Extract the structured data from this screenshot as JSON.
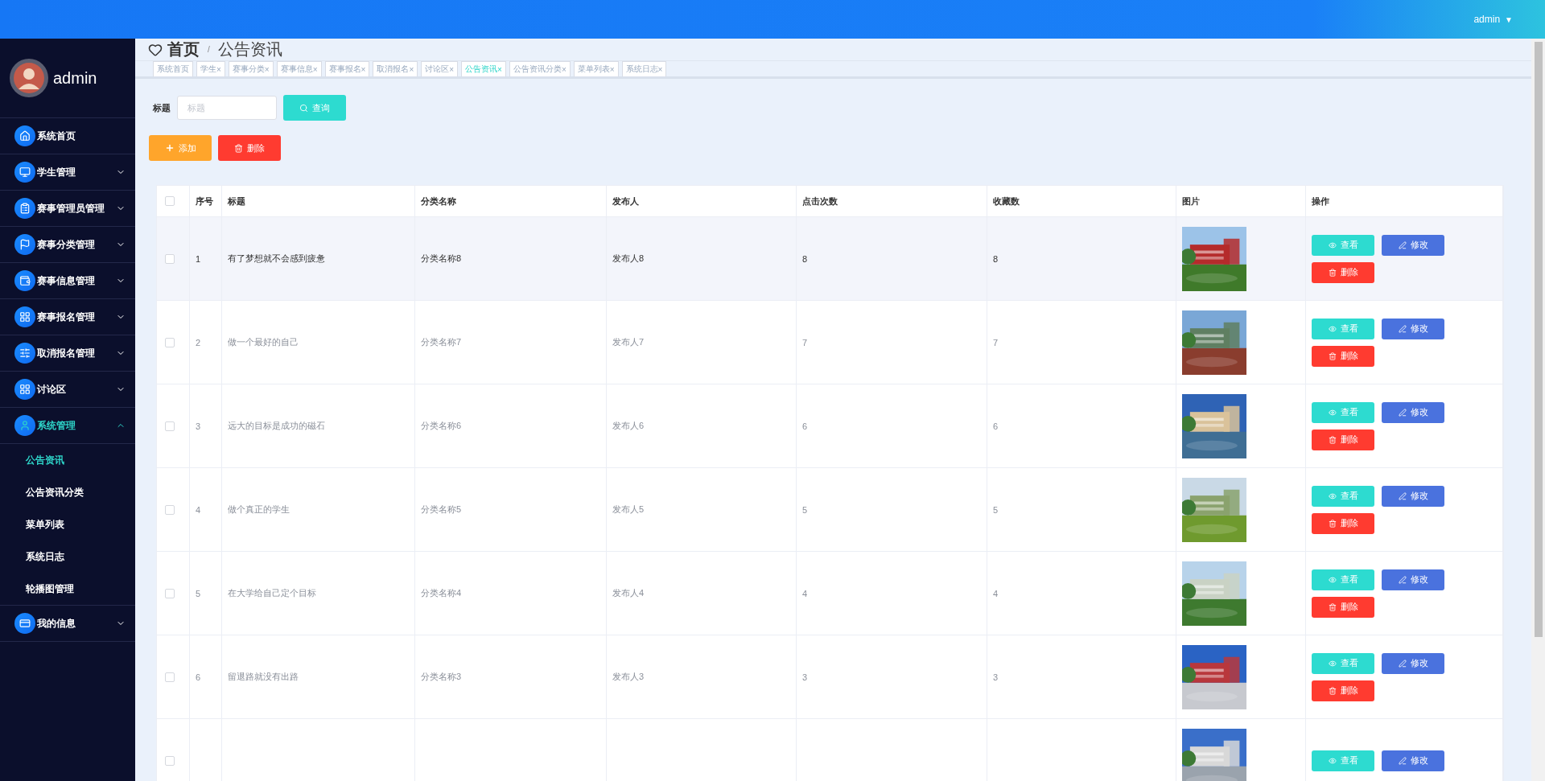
{
  "topbar": {
    "user": "admin",
    "caret": "▼"
  },
  "sidebar": {
    "username": "admin",
    "items": [
      {
        "label": "系统首页",
        "selected": false
      },
      {
        "label": "学生管理",
        "expanded": false,
        "selected": false
      },
      {
        "label": "赛事管理员管理",
        "expanded": false,
        "selected": false
      },
      {
        "label": "赛事分类管理",
        "expanded": false,
        "selected": false
      },
      {
        "label": "赛事信息管理",
        "expanded": false,
        "selected": false
      },
      {
        "label": "赛事报名管理",
        "expanded": false,
        "selected": false
      },
      {
        "label": "取消报名管理",
        "expanded": false,
        "selected": false
      },
      {
        "label": "讨论区",
        "expanded": false,
        "selected": false
      },
      {
        "label": "系统管理",
        "expanded": true,
        "selected": true,
        "children": [
          {
            "label": "公告资讯",
            "selected": true
          },
          {
            "label": "公告资讯分类",
            "selected": false
          },
          {
            "label": "菜单列表",
            "selected": false
          },
          {
            "label": "系统日志",
            "selected": false
          },
          {
            "label": "轮播图管理",
            "selected": false
          }
        ]
      },
      {
        "label": "我的信息",
        "expanded": false,
        "selected": false
      }
    ]
  },
  "breadcrumb": {
    "home": "首页",
    "separator": "/",
    "current": "公告资讯"
  },
  "tabs": [
    {
      "label": "系统首页",
      "selected": false
    },
    {
      "label": "学生",
      "close": "×",
      "selected": false
    },
    {
      "label": "赛事分类",
      "close": "×",
      "selected": false
    },
    {
      "label": "赛事信息",
      "close": "×",
      "selected": false
    },
    {
      "label": "赛事报名",
      "close": "×",
      "selected": false
    },
    {
      "label": "取消报名",
      "close": "×",
      "selected": false
    },
    {
      "label": "讨论区",
      "close": "×",
      "selected": false
    },
    {
      "label": "公告资讯",
      "close": "×",
      "selected": true
    },
    {
      "label": "公告资讯分类",
      "close": "×",
      "selected": false
    },
    {
      "label": "菜单列表",
      "close": "×",
      "selected": false
    },
    {
      "label": "系统日志",
      "close": "×",
      "selected": false
    }
  ],
  "search": {
    "label": "标题",
    "placeholder": "标题",
    "button": "查询"
  },
  "actions": {
    "add": "添加",
    "delete": "删除"
  },
  "table": {
    "select_all": {
      "checked": false
    },
    "columns": [
      "序号",
      "标题",
      "分类名称",
      "发布人",
      "点击次数",
      "收藏数",
      "图片",
      "操作"
    ],
    "rows": [
      {
        "hovered": true,
        "checked": false,
        "cells": [
          "1",
          "有了梦想就不会感到疲惫",
          "分类名称8",
          "发布人8",
          "8",
          "8"
        ],
        "picture": {
          "kind": "picture"
        },
        "buttons": [
          "查看",
          "修改",
          "删除"
        ]
      },
      {
        "hovered": false,
        "checked": false,
        "cells": [
          "2",
          "做一个最好的自己",
          "分类名称7",
          "发布人7",
          "7",
          "7"
        ],
        "picture": {
          "kind": "picture"
        },
        "buttons": [
          "查看",
          "修改",
          "删除"
        ]
      },
      {
        "hovered": false,
        "checked": false,
        "cells": [
          "3",
          "远大的目标是成功的磁石",
          "分类名称6",
          "发布人6",
          "6",
          "6"
        ],
        "picture": {
          "kind": "picture"
        },
        "buttons": [
          "查看",
          "修改",
          "删除"
        ]
      },
      {
        "hovered": false,
        "checked": false,
        "cells": [
          "4",
          "做个真正的学生",
          "分类名称5",
          "发布人5",
          "5",
          "5"
        ],
        "picture": {
          "kind": "picture"
        },
        "buttons": [
          "查看",
          "修改",
          "删除"
        ]
      },
      {
        "hovered": false,
        "checked": false,
        "cells": [
          "5",
          "在大学给自己定个目标",
          "分类名称4",
          "发布人4",
          "4",
          "4"
        ],
        "picture": {
          "kind": "picture"
        },
        "buttons": [
          "查看",
          "修改",
          "删除"
        ]
      },
      {
        "hovered": false,
        "checked": false,
        "cells": [
          "6",
          "留退路就没有出路",
          "分类名称3",
          "发布人3",
          "3",
          "3"
        ],
        "picture": {
          "kind": "picture"
        },
        "buttons": [
          "查看",
          "修改",
          "删除"
        ]
      },
      {
        "hovered": false,
        "checked": false,
        "cells": [],
        "picture": {
          "kind": "picture"
        },
        "buttons": [
          "查看",
          "修改"
        ]
      }
    ]
  }
}
